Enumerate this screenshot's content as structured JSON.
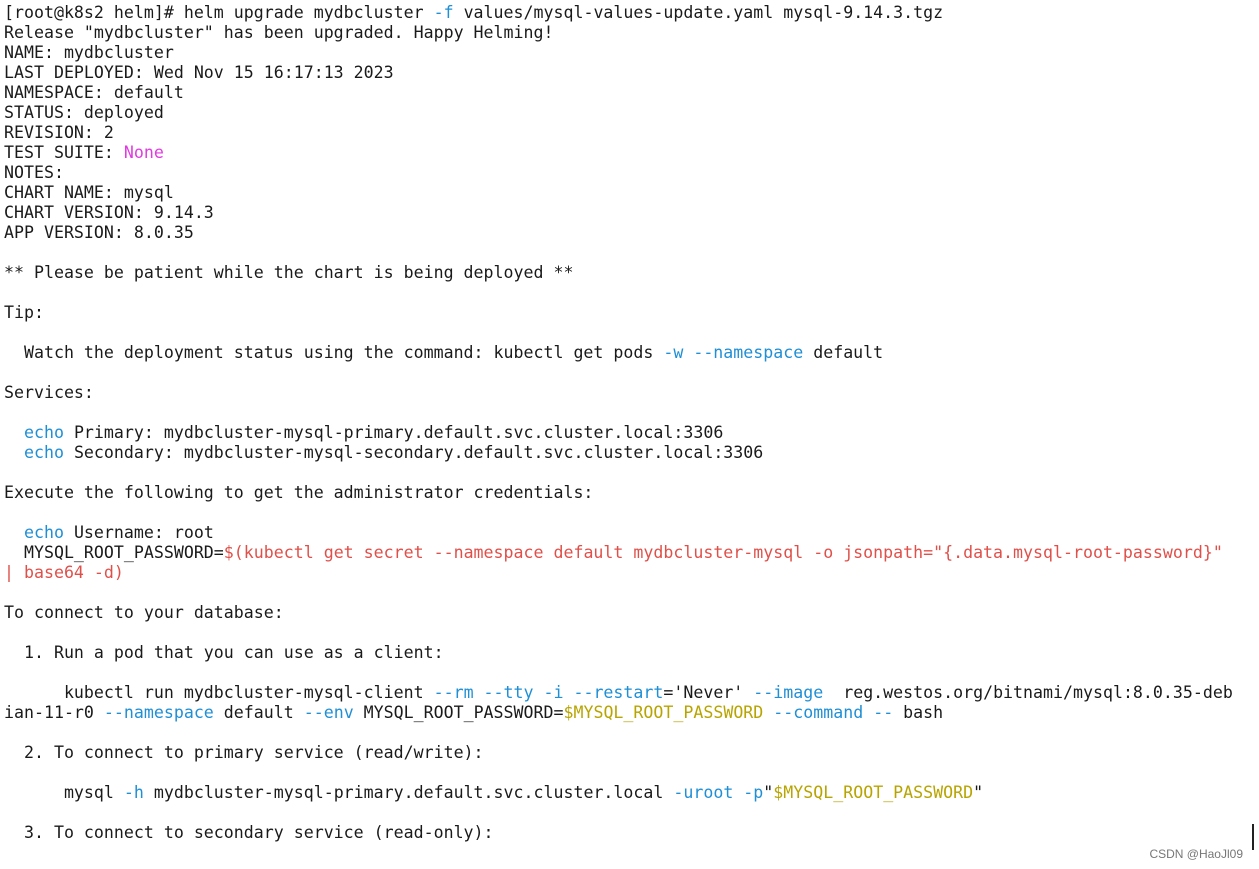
{
  "terminal": {
    "lines": [
      [
        {
          "t": "[root@k8s2 helm]# helm upgrade mydbcluster "
        },
        {
          "t": "-f",
          "c": "blue"
        },
        {
          "t": " values/mysql-values-update.yaml mysql-9.14.3.tgz"
        }
      ],
      [
        {
          "t": "Release \"mydbcluster\" has been upgraded. Happy Helming!"
        }
      ],
      [
        {
          "t": "NAME: mydbcluster"
        }
      ],
      [
        {
          "t": "LAST DEPLOYED: Wed Nov 15 16:17:13 2023"
        }
      ],
      [
        {
          "t": "NAMESPACE: default"
        }
      ],
      [
        {
          "t": "STATUS: deployed"
        }
      ],
      [
        {
          "t": "REVISION: 2"
        }
      ],
      [
        {
          "t": "TEST SUITE: "
        },
        {
          "t": "None",
          "c": "magenta"
        }
      ],
      [
        {
          "t": "NOTES:"
        }
      ],
      [
        {
          "t": "CHART NAME: mysql"
        }
      ],
      [
        {
          "t": "CHART VERSION: 9.14.3"
        }
      ],
      [
        {
          "t": "APP VERSION: 8.0.35"
        }
      ],
      [],
      [
        {
          "t": "** Please be patient while the chart is being deployed **"
        }
      ],
      [],
      [
        {
          "t": "Tip:"
        }
      ],
      [],
      [
        {
          "t": "  Watch the deployment status using the command: kubectl get pods "
        },
        {
          "t": "-w --namespace",
          "c": "blue"
        },
        {
          "t": " default"
        }
      ],
      [],
      [
        {
          "t": "Services:"
        }
      ],
      [],
      [
        {
          "t": "  "
        },
        {
          "t": "echo",
          "c": "blue"
        },
        {
          "t": " Primary: mydbcluster-mysql-primary.default.svc.cluster.local:3306"
        }
      ],
      [
        {
          "t": "  "
        },
        {
          "t": "echo",
          "c": "blue"
        },
        {
          "t": " Secondary: mydbcluster-mysql-secondary.default.svc.cluster.local:3306"
        }
      ],
      [],
      [
        {
          "t": "Execute the following to get the administrator credentials:"
        }
      ],
      [],
      [
        {
          "t": "  "
        },
        {
          "t": "echo",
          "c": "blue"
        },
        {
          "t": " Username: root"
        }
      ],
      [
        {
          "t": "  MYSQL_ROOT_PASSWORD="
        },
        {
          "t": "$(kubectl get secret --namespace default mydbcluster-mysql -o jsonpath=\"{.data.mysql-root-password}\"",
          "c": "red"
        }
      ],
      [
        {
          "t": "| base64 -d)",
          "c": "red"
        }
      ],
      [],
      [
        {
          "t": "To connect to your database:"
        }
      ],
      [],
      [
        {
          "t": "  1. Run a pod that you can use as a client:"
        }
      ],
      [],
      [
        {
          "t": "      kubectl run mydbcluster-mysql-client "
        },
        {
          "t": "--rm --tty -i --restart",
          "c": "blue"
        },
        {
          "t": "='Never' "
        },
        {
          "t": "--image",
          "c": "blue"
        },
        {
          "t": "  reg.westos.org/bitnami/mysql:8.0.35-deb"
        }
      ],
      [
        {
          "t": "ian-11-r0 "
        },
        {
          "t": "--namespace",
          "c": "blue"
        },
        {
          "t": " default "
        },
        {
          "t": "--env",
          "c": "blue"
        },
        {
          "t": " MYSQL_ROOT_PASSWORD="
        },
        {
          "t": "$MYSQL_ROOT_PASSWORD",
          "c": "yellow"
        },
        {
          "t": " "
        },
        {
          "t": "--command --",
          "c": "blue"
        },
        {
          "t": " bash"
        }
      ],
      [],
      [
        {
          "t": "  2. To connect to primary service (read/write):"
        }
      ],
      [],
      [
        {
          "t": "      mysql "
        },
        {
          "t": "-h",
          "c": "blue"
        },
        {
          "t": " mydbcluster-mysql-primary.default.svc.cluster.local "
        },
        {
          "t": "-uroot -p",
          "c": "blue"
        },
        {
          "t": "\""
        },
        {
          "t": "$MYSQL_ROOT_PASSWORD",
          "c": "yellow"
        },
        {
          "t": "\""
        }
      ],
      [],
      [
        {
          "t": "  3. To connect to secondary service (read-only):"
        }
      ]
    ]
  },
  "watermark": "CSDN @HaoJl09",
  "colors": {
    "blue": "#1f8fd6",
    "magenta": "#e03be0",
    "red": "#e0504a",
    "yellow": "#b8a400"
  }
}
